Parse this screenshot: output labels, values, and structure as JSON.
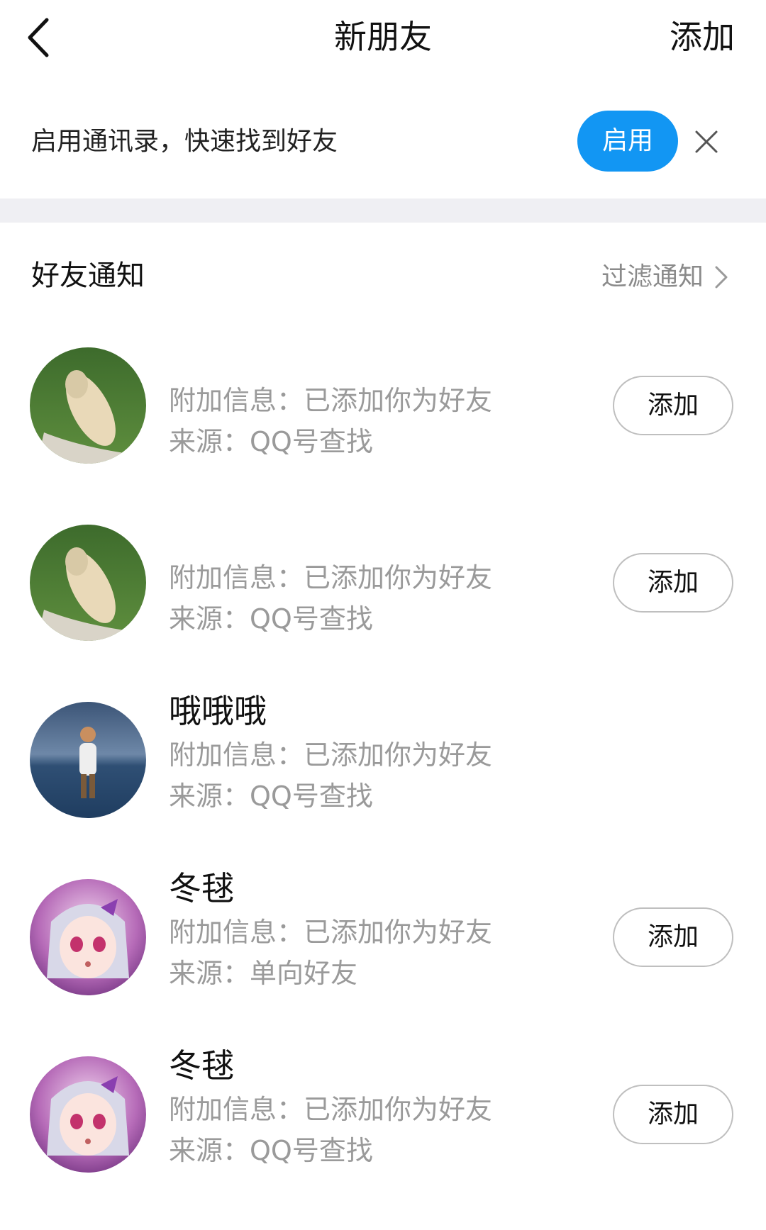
{
  "header": {
    "title": "新朋友",
    "add_label": "添加"
  },
  "banner": {
    "text": "启用通讯录，快速找到好友",
    "enable_label": "启用"
  },
  "section": {
    "title": "好友通知",
    "filter_label": "过滤通知"
  },
  "requests": [
    {
      "name": "",
      "info": "附加信息：已添加你为好友",
      "source": "来源：QQ号查找",
      "action_label": "添加",
      "avatar": "avatar-girl-on-grass"
    },
    {
      "name": "",
      "info": "附加信息：已添加你为好友",
      "source": "来源：QQ号查找",
      "action_label": "添加",
      "avatar": "avatar-girl-on-grass"
    },
    {
      "name": "哦哦哦",
      "info": "附加信息：已添加你为好友",
      "source": "来源：QQ号查找",
      "action_label": "",
      "avatar": "avatar-boy-by-sea"
    },
    {
      "name": "冬毬",
      "info": "附加信息：已添加你为好友",
      "source": "来源：单向好友",
      "action_label": "添加",
      "avatar": "avatar-anime-girl"
    },
    {
      "name": "冬毬",
      "info": "附加信息：已添加你为好友",
      "source": "来源：QQ号查找",
      "action_label": "添加",
      "avatar": "avatar-anime-girl"
    }
  ],
  "colors": {
    "accent": "#1296f3",
    "secondary_text": "#9a9a9a",
    "band": "#efeff3"
  }
}
